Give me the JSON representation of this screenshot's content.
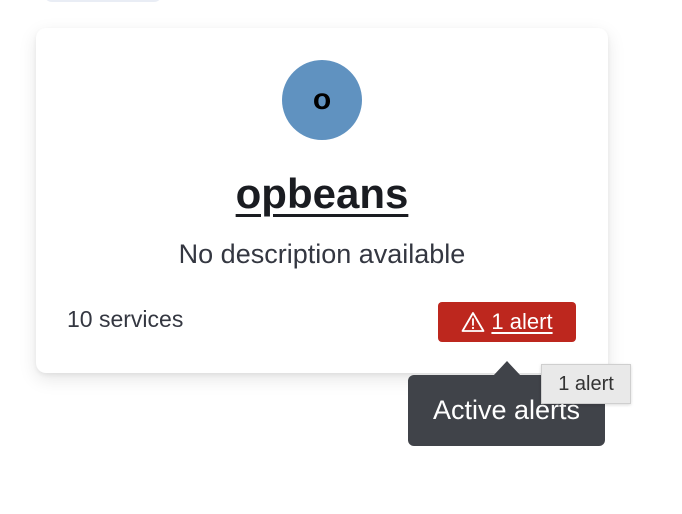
{
  "card": {
    "avatar_letter": "o",
    "title": "opbeans",
    "description": "No description available",
    "services_count": "10 services",
    "alert_badge": {
      "icon": "warning-triangle-icon",
      "label": "1 alert"
    }
  },
  "tooltip": {
    "text": "Active alerts"
  },
  "native_tooltip": {
    "text": "1 alert"
  },
  "colors": {
    "avatar": "#6092c0",
    "alert": "#bd271e",
    "tooltip_bg": "#404349"
  }
}
